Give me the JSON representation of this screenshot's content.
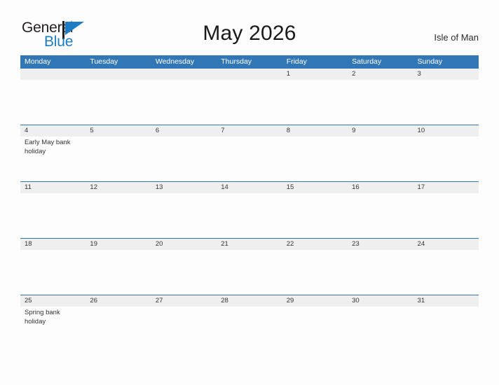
{
  "brand": {
    "name_part1": "General",
    "name_part2": "Blue",
    "flag_icon": "flag-icon",
    "accent_color": "#1c7cc4"
  },
  "header": {
    "title": "May 2026",
    "region": "Isle of Man"
  },
  "theme": {
    "header_blue": "#3176b5",
    "date_band_gray": "#efefef",
    "page_background": "#fdfdfd",
    "text_color": "#333333"
  },
  "calendar": {
    "month": "May",
    "year": "2026",
    "weekday_headers": [
      "Monday",
      "Tuesday",
      "Wednesday",
      "Thursday",
      "Friday",
      "Saturday",
      "Sunday"
    ],
    "weeks": [
      {
        "dates": [
          "",
          "",
          "",
          "",
          "1",
          "2",
          "3"
        ],
        "events": [
          "",
          "",
          "",
          "",
          "",
          "",
          ""
        ]
      },
      {
        "dates": [
          "4",
          "5",
          "6",
          "7",
          "8",
          "9",
          "10"
        ],
        "events": [
          "Early May bank holiday",
          "",
          "",
          "",
          "",
          "",
          ""
        ]
      },
      {
        "dates": [
          "11",
          "12",
          "13",
          "14",
          "15",
          "16",
          "17"
        ],
        "events": [
          "",
          "",
          "",
          "",
          "",
          "",
          ""
        ]
      },
      {
        "dates": [
          "18",
          "19",
          "20",
          "21",
          "22",
          "23",
          "24"
        ],
        "events": [
          "",
          "",
          "",
          "",
          "",
          "",
          ""
        ]
      },
      {
        "dates": [
          "25",
          "26",
          "27",
          "28",
          "29",
          "30",
          "31"
        ],
        "events": [
          "Spring bank holiday",
          "",
          "",
          "",
          "",
          "",
          ""
        ]
      }
    ]
  }
}
